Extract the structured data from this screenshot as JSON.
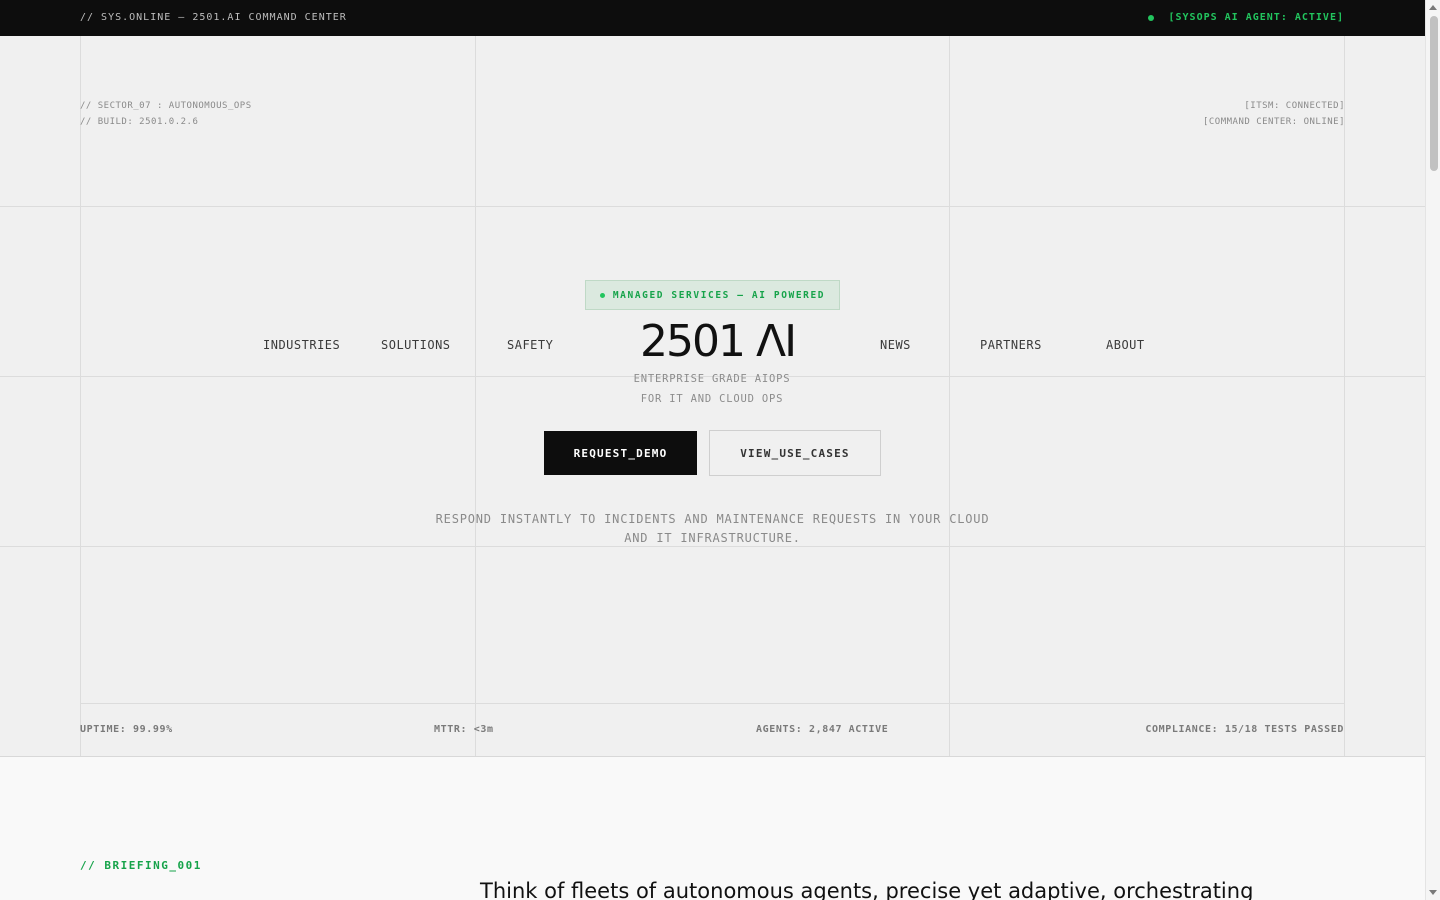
{
  "topbar": {
    "left_text": "// SYS.ONLINE — 2501.AI COMMAND CENTER",
    "status_text": "[SYSOPS AI AGENT: ACTIVE]",
    "status_color": "#22c55e"
  },
  "meta": {
    "sector": "// SECTOR_07 : AUTONOMOUS_OPS",
    "build": "// BUILD: 2501.0.2.6",
    "itsm": "[ITSM: CONNECTED]",
    "command_center": "[COMMAND CENTER: ONLINE]"
  },
  "badge": {
    "label": "MANAGED SERVICES — AI POWERED"
  },
  "nav": {
    "items": [
      "INDUSTRIES",
      "SOLUTIONS",
      "SAFETY",
      "NEWS",
      "PARTNERS",
      "ABOUT"
    ]
  },
  "logo": {
    "text": "2501 ΛI"
  },
  "tagline": {
    "line1": "ENTERPRISE GRADE AIOPS",
    "line2": "FOR IT AND CLOUD OPS"
  },
  "buttons": {
    "primary": "REQUEST_DEMO",
    "secondary": "VIEW_USE_CASES"
  },
  "description": "RESPOND INSTANTLY TO INCIDENTS AND MAINTENANCE REQUESTS IN YOUR CLOUD AND IT INFRASTRUCTURE.",
  "stats": {
    "uptime": "UPTIME: 99.99%",
    "mttr": "MTTR: <3m",
    "agents": "AGENTS: 2,847 ACTIVE",
    "compliance": "COMPLIANCE: 15/18 TESTS PASSED"
  },
  "briefing": {
    "label": "// BRIEFING_001",
    "lead": "Think of fleets of autonomous agents, precise yet adaptive, orchestrating"
  },
  "colors": {
    "accent": "#16a34a",
    "dark": "#0d0d0d",
    "background": "#f0f0f0"
  }
}
